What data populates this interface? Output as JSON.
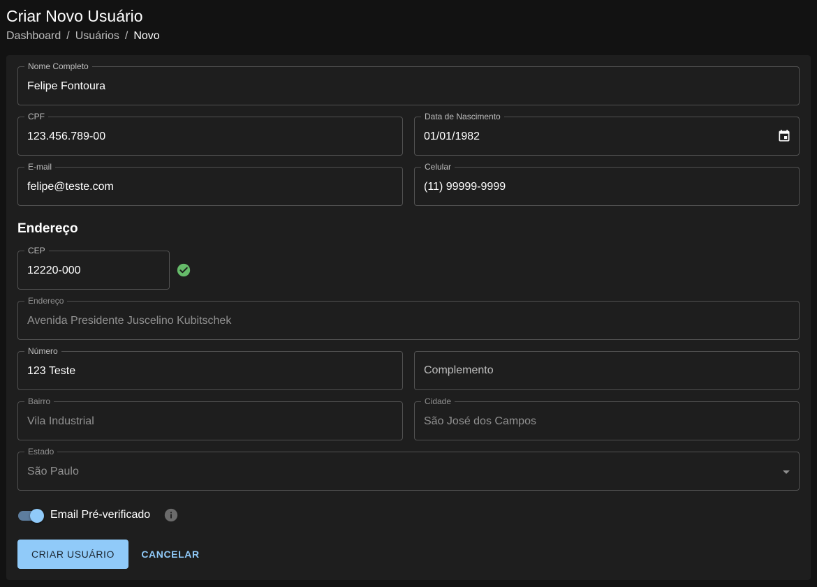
{
  "header": {
    "title": "Criar Novo Usuário",
    "breadcrumb": [
      "Dashboard",
      "Usuários",
      "Novo"
    ],
    "separator": "/"
  },
  "form": {
    "nome": {
      "label": "Nome Completo",
      "value": "Felipe Fontoura"
    },
    "cpf": {
      "label": "CPF",
      "value": "123.456.789-00"
    },
    "nascimento": {
      "label": "Data de Nascimento",
      "value": "01/01/1982",
      "icon": "calendar-icon"
    },
    "email": {
      "label": "E-mail",
      "value": "felipe@teste.com"
    },
    "celular": {
      "label": "Celular",
      "value": "(11) 99999-9999"
    },
    "endereco_section": "Endereço",
    "cep": {
      "label": "CEP",
      "value": "12220-000",
      "status_icon": "check-circle-icon"
    },
    "endereco": {
      "label": "Endereço",
      "value": "Avenida Presidente Juscelino Kubitschek"
    },
    "numero": {
      "label": "Número",
      "value": "123 Teste"
    },
    "complemento": {
      "placeholder": "Complemento"
    },
    "bairro": {
      "label": "Bairro",
      "value": "Vila Industrial"
    },
    "cidade": {
      "label": "Cidade",
      "value": "São José dos Campos"
    },
    "estado": {
      "label": "Estado",
      "value": "São Paulo"
    },
    "email_verificado": {
      "label": "Email Pré-verificado",
      "checked": true,
      "info_icon": "info-icon"
    }
  },
  "actions": {
    "submit": "CRIAR USUÁRIO",
    "cancel": "CANCELAR"
  },
  "colors": {
    "background": "#121212",
    "card": "#1e1e1e",
    "primary": "#90caf9",
    "success": "#66bb6a"
  }
}
